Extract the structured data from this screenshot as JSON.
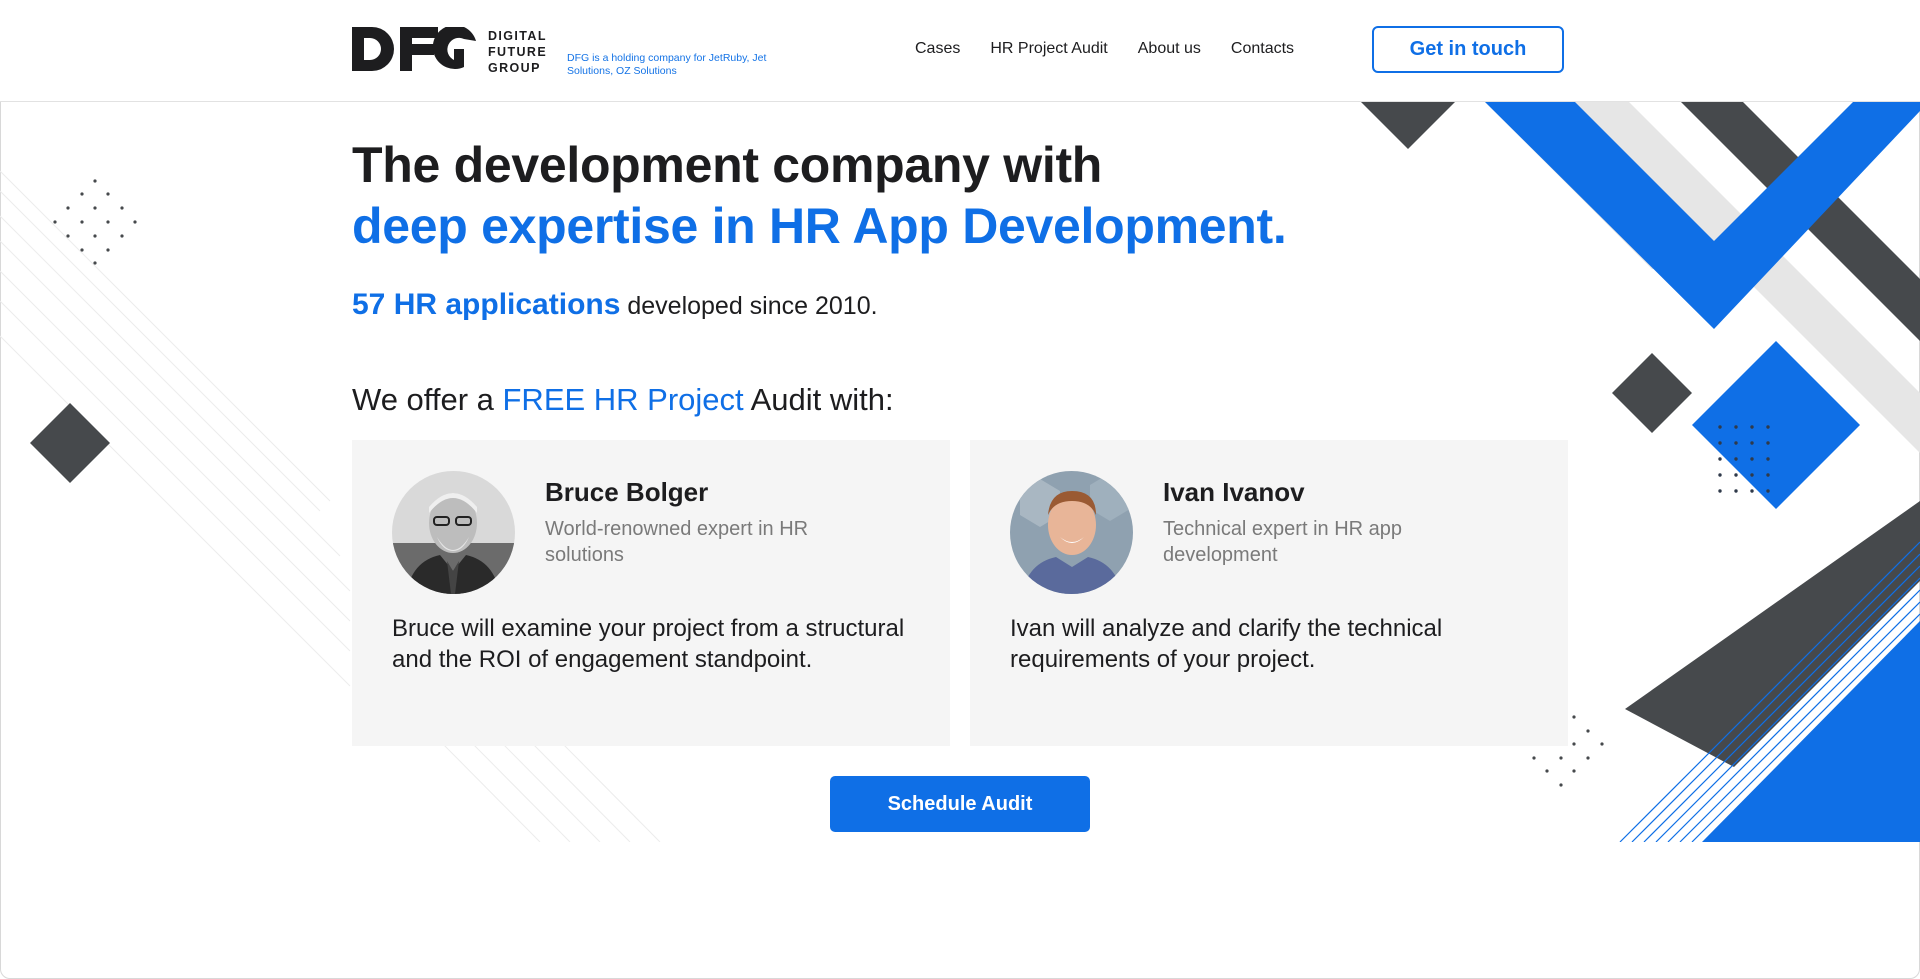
{
  "header": {
    "logo_mark": "DFG",
    "logo_words": [
      "DIGITAL",
      "FUTURE",
      "GROUP"
    ],
    "logo_subtitle": "DFG is a holding company for JetRuby, Jet Solutions, OZ Solutions",
    "nav": [
      "Cases",
      "HR Project Audit",
      "About us",
      "Contacts"
    ],
    "cta_label": "Get in touch"
  },
  "hero": {
    "line1": "The development company with",
    "line2": "deep expertise in HR App Development.",
    "stat_highlight": "57 HR applications",
    "stat_rest": " developed since 2010.",
    "offer_prefix": "We offer a ",
    "offer_highlight": "FREE HR Project",
    "offer_suffix": " Audit with:"
  },
  "experts": [
    {
      "name": "Bruce Bolger",
      "role": "World-renowned expert in HR solutions",
      "description": "Bruce will examine your project from a structural and the ROI of engagement standpoint."
    },
    {
      "name": "Ivan Ivanov",
      "role": "Technical expert in HR app development",
      "description": "Ivan will analyze and clarify the technical requirements of your project."
    }
  ],
  "schedule_label": "Schedule Audit",
  "colors": {
    "accent": "#0f6fe6",
    "dark": "#46494c",
    "card_bg": "#f5f5f5"
  }
}
